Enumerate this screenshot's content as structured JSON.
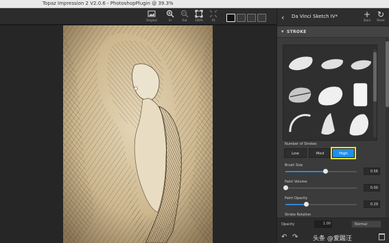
{
  "window": {
    "title": "Topaz Impression 2 V2.0.6 - PhotoshopPlugin @ 39.3%"
  },
  "toolbar": {
    "buttons": [
      {
        "label": "Original",
        "icon": "image-icon"
      },
      {
        "label": "In",
        "icon": "zoom-in-icon"
      },
      {
        "label": "Out",
        "icon": "zoom-out-icon"
      },
      {
        "label": "100%",
        "icon": "actual-size-icon"
      },
      {
        "label": "Fit",
        "icon": "fit-screen-icon"
      }
    ],
    "view_modes": [
      "single-view",
      "split-view",
      "side-by-side",
      "compare"
    ]
  },
  "panel": {
    "back_icon": "chevron-left-icon",
    "preset_name": "Da Vinci Sketch IV*",
    "store_label": "Store",
    "reset_label": "Reset",
    "section_title": "STROKE",
    "number_of_strokes": {
      "label": "Number of Strokes",
      "options": [
        "Low",
        "Med",
        "High"
      ],
      "selected": "High"
    },
    "sliders": [
      {
        "label": "Brush Size",
        "value": "0.56",
        "level": 0.56
      },
      {
        "label": "Paint Volume",
        "value": "0.00",
        "level": 0.0
      },
      {
        "label": "Paint Opacity",
        "value": "0.29",
        "level": 0.29
      }
    ],
    "next_label": "Stroke Rotation",
    "footer": {
      "opacity_label": "Opacity",
      "opacity_value": "1.00",
      "blend_mode": "Normal",
      "watermark": "头条 @爱踢汪"
    }
  },
  "colors": {
    "accent": "#1f8ef0",
    "highlight_outline": "#e5e532",
    "panel_bg": "#3b3b3b"
  }
}
